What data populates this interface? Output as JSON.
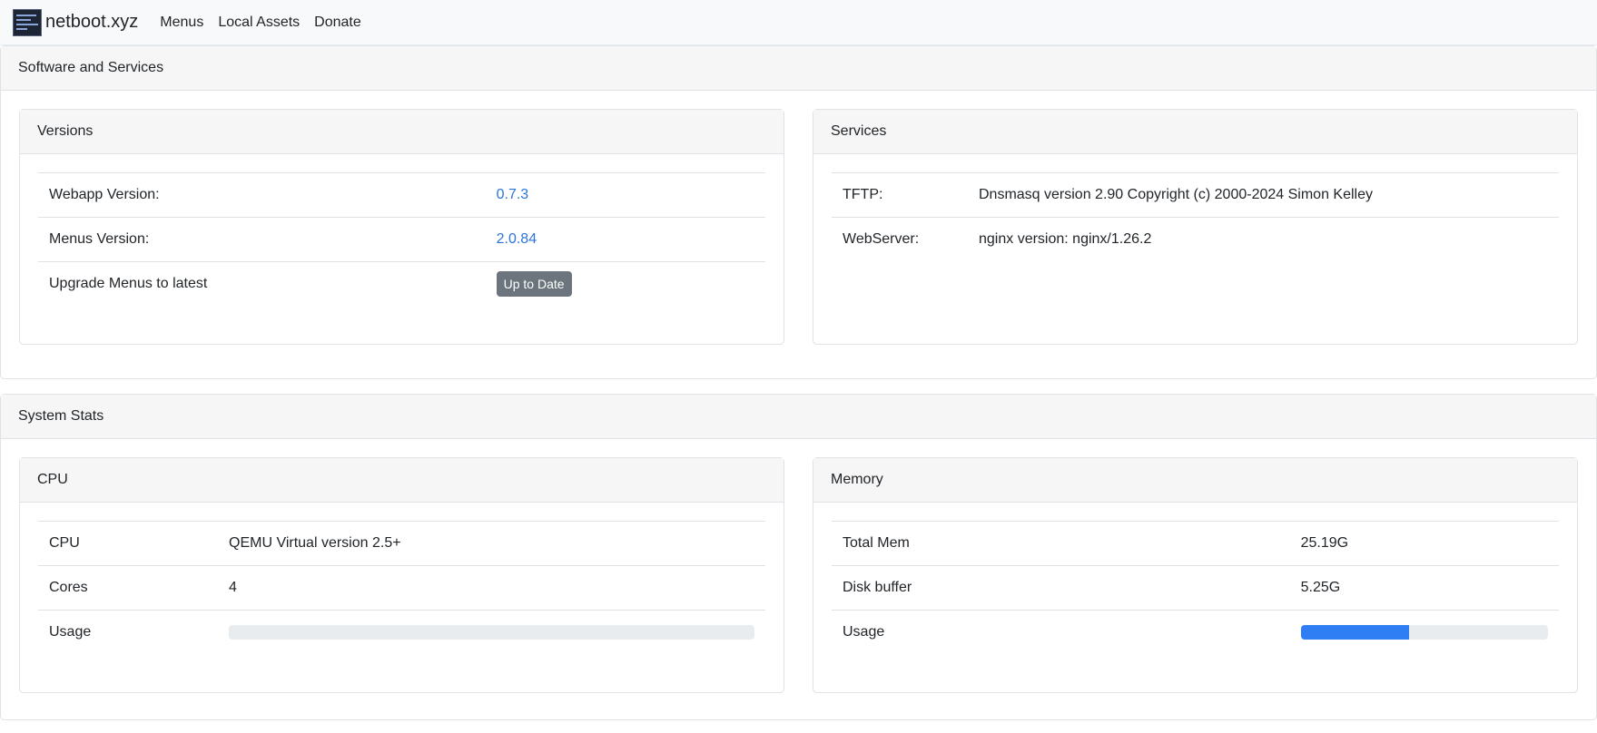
{
  "navbar": {
    "brand": "netboot.xyz",
    "links": [
      "Menus",
      "Local Assets",
      "Donate"
    ]
  },
  "software": {
    "title": "Software and Services",
    "versions": {
      "title": "Versions",
      "rows": [
        {
          "label": "Webapp Version:",
          "value": "0.7.3"
        },
        {
          "label": "Menus Version:",
          "value": "2.0.84"
        },
        {
          "label": "Upgrade Menus to latest",
          "button": "Up to Date"
        }
      ]
    },
    "services": {
      "title": "Services",
      "rows": [
        {
          "label": "TFTP:",
          "value": "Dnsmasq version 2.90 Copyright (c) 2000-2024 Simon Kelley"
        },
        {
          "label": "WebServer:",
          "value": "nginx version: nginx/1.26.2"
        }
      ]
    }
  },
  "system": {
    "title": "System Stats",
    "cpu": {
      "title": "CPU",
      "rows": [
        {
          "label": "CPU",
          "value": "QEMU Virtual version 2.5+"
        },
        {
          "label": "Cores",
          "value": "4"
        },
        {
          "label": "Usage"
        }
      ],
      "usage_percent": 0
    },
    "memory": {
      "title": "Memory",
      "rows": [
        {
          "label": "Total Mem",
          "value": "25.19G"
        },
        {
          "label": "Disk buffer",
          "value": "5.25G"
        },
        {
          "label": "Usage"
        }
      ],
      "usage_percent": 44
    }
  },
  "colors": {
    "link": "#2a74d9",
    "button": "#6c757d",
    "progress": "#2f7ef4"
  },
  "icons": {
    "brand_logo": "netboot-logo-icon"
  }
}
